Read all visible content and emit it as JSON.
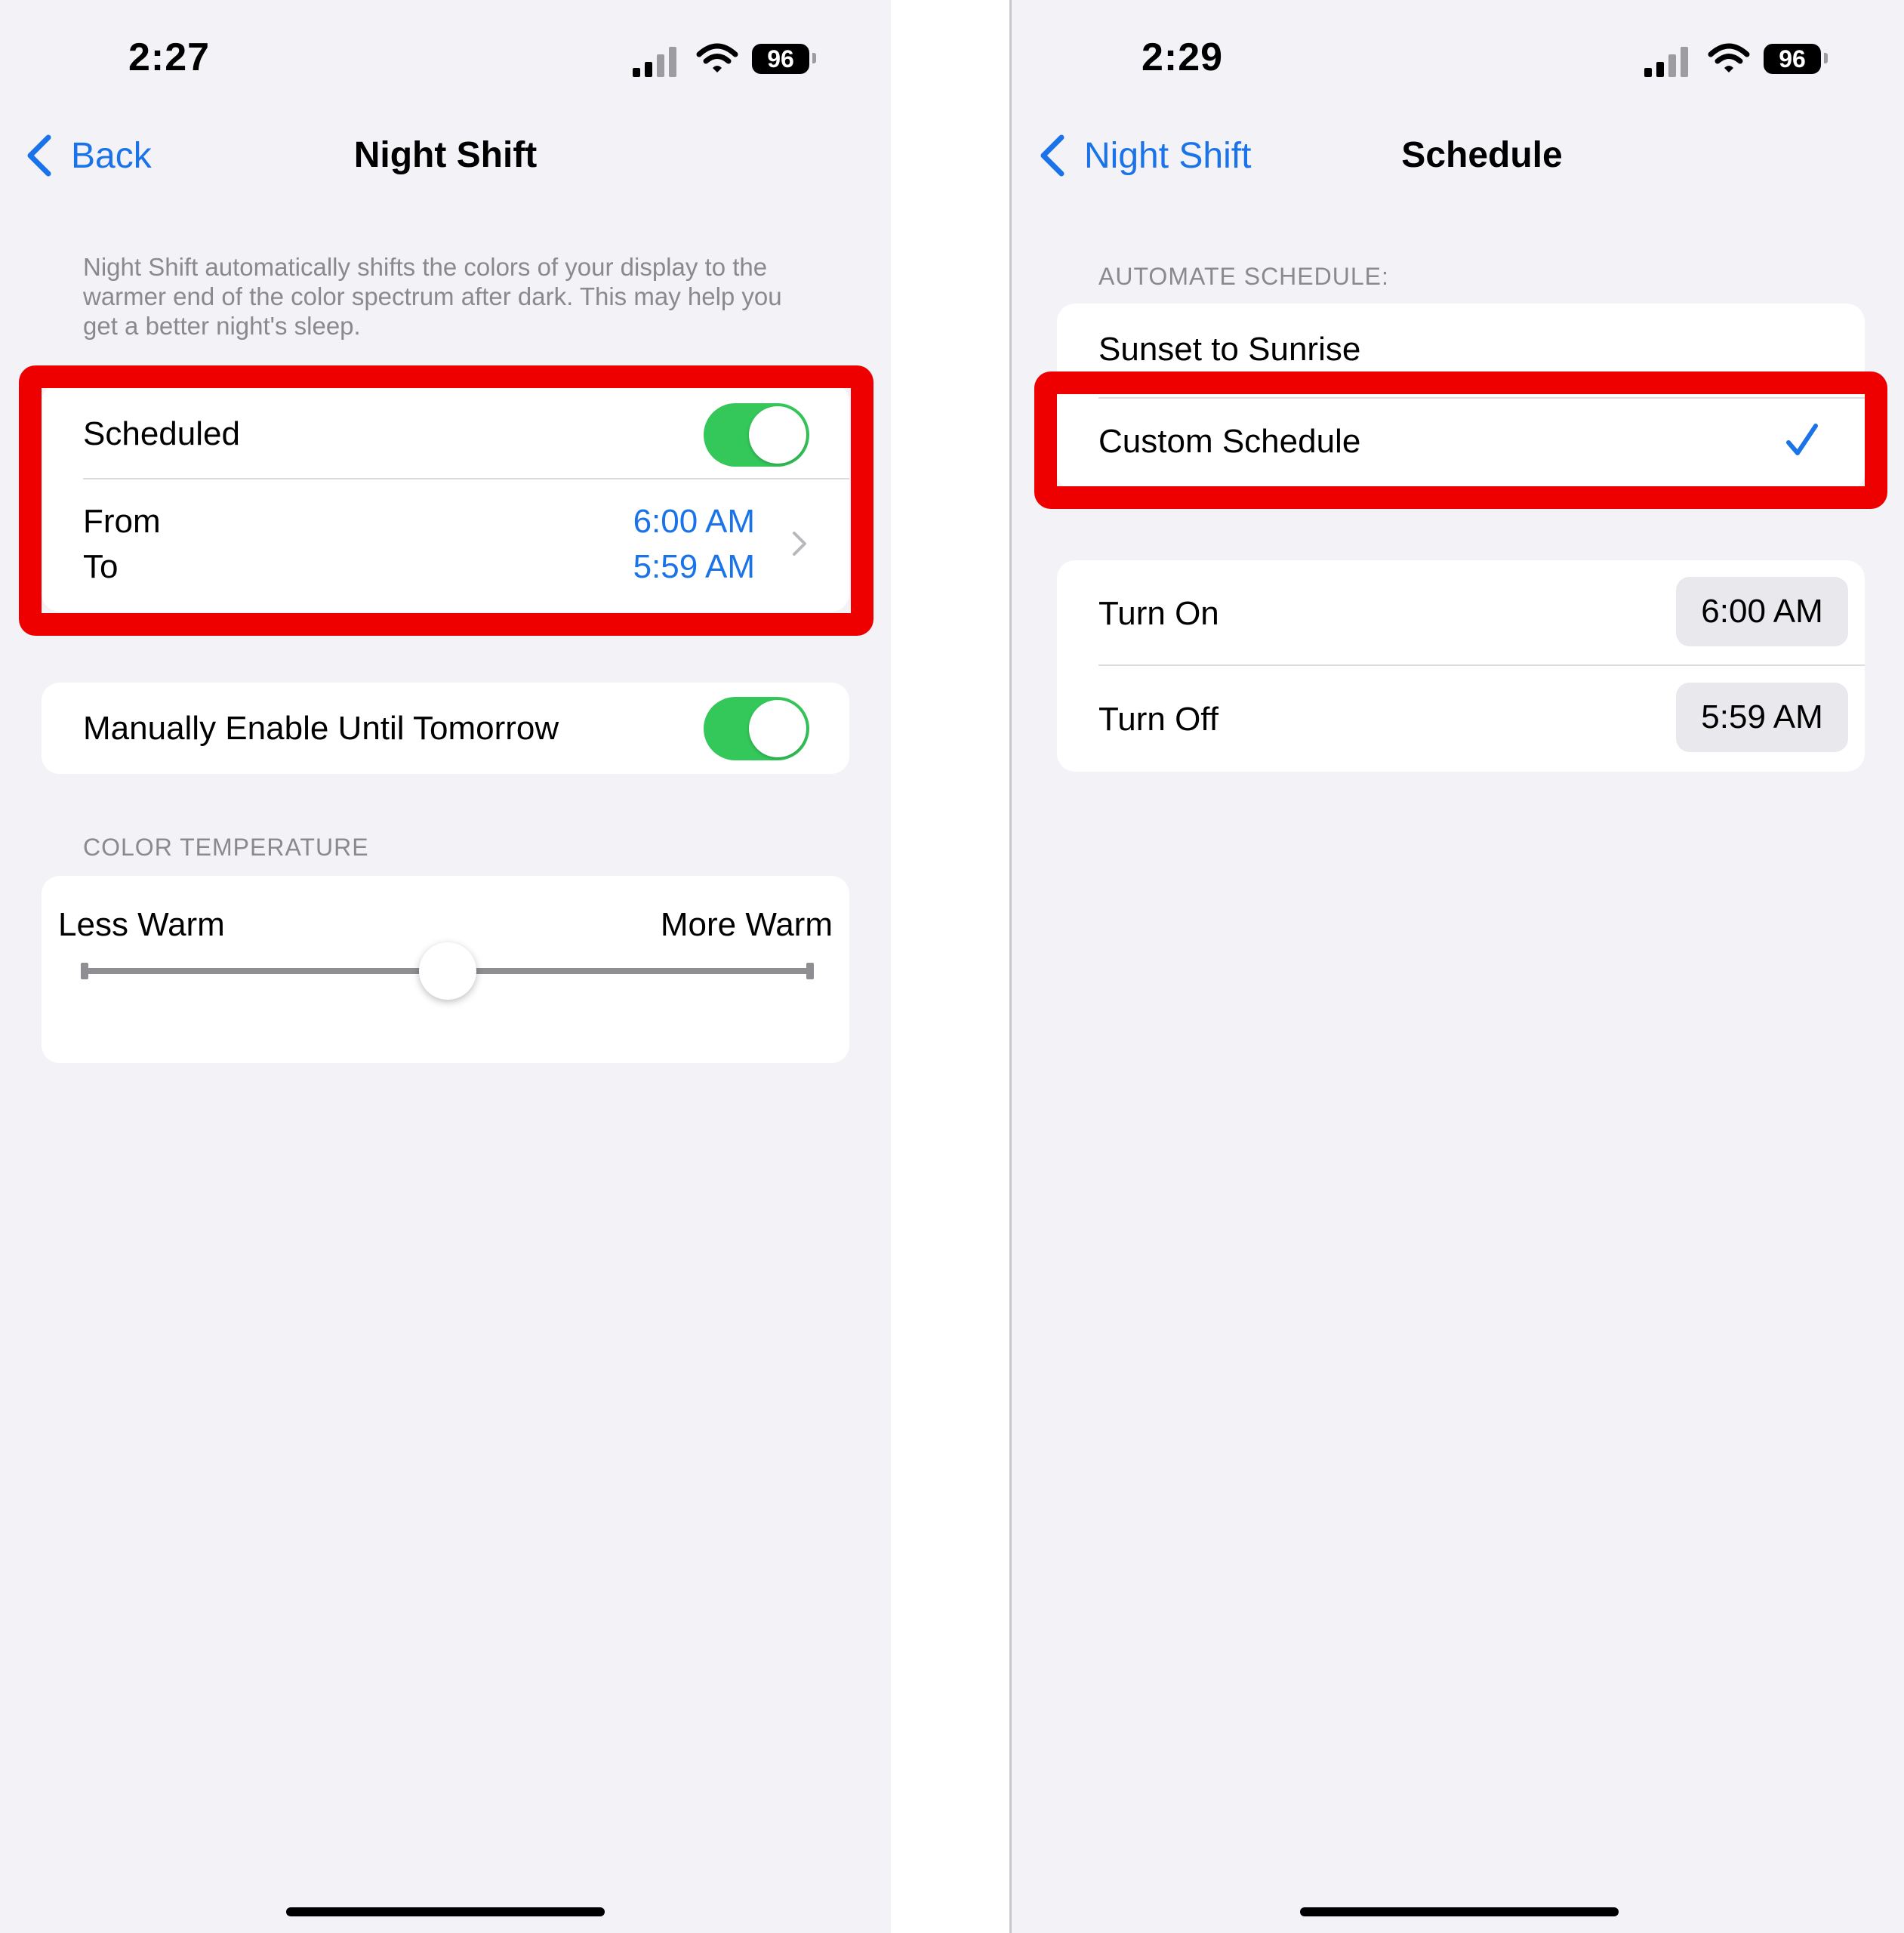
{
  "left": {
    "status": {
      "time": "2:27",
      "battery": "96"
    },
    "nav": {
      "back_label": "Back",
      "title": "Night Shift"
    },
    "description": "Night Shift automatically shifts the colors of your display to the warmer end of the color spectrum after dark. This may help you get a better night's sleep.",
    "scheduled": {
      "label": "Scheduled",
      "enabled": true
    },
    "schedule_times": {
      "from_label": "From",
      "to_label": "To",
      "from_value": "6:00 AM",
      "to_value": "5:59 AM"
    },
    "manual": {
      "label": "Manually Enable Until Tomorrow",
      "enabled": true
    },
    "color_temperature": {
      "header": "COLOR TEMPERATURE",
      "less_label": "Less Warm",
      "more_label": "More Warm",
      "level": 0.5
    }
  },
  "right": {
    "status": {
      "time": "2:29",
      "battery": "96"
    },
    "nav": {
      "back_label": "Night Shift",
      "title": "Schedule"
    },
    "automate": {
      "header": "AUTOMATE SCHEDULE:",
      "options": [
        {
          "label": "Sunset to Sunrise",
          "selected": false
        },
        {
          "label": "Custom Schedule",
          "selected": true
        }
      ]
    },
    "times": {
      "turn_on_label": "Turn On",
      "turn_on_value": "6:00 AM",
      "turn_off_label": "Turn Off",
      "turn_off_value": "5:59 AM"
    }
  },
  "colors": {
    "accent": "#1a73e8",
    "toggle_on": "#34c759",
    "highlight": "#ee0000",
    "background": "#f2f2f7"
  }
}
